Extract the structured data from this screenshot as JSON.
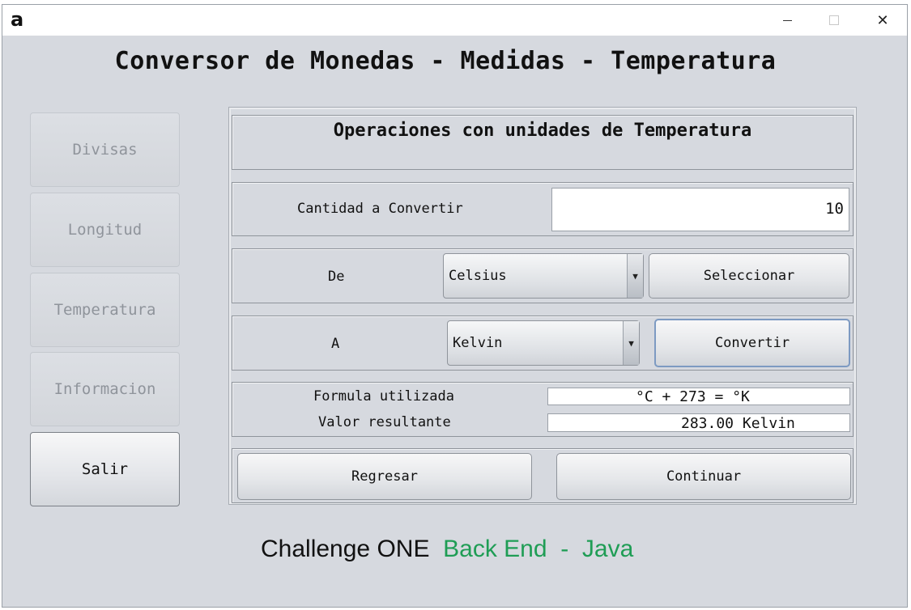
{
  "window": {
    "app_icon": "a",
    "minimize_icon": "minimize-icon",
    "maximize_icon": "maximize-icon",
    "close_icon": "close-icon",
    "close_glyph": "✕"
  },
  "app_title": "Conversor de Monedas - Medidas - Temperatura",
  "sidebar": {
    "items": [
      {
        "label": "Divisas"
      },
      {
        "label": "Longitud"
      },
      {
        "label": "Temperatura"
      },
      {
        "label": "Informacion"
      },
      {
        "label": "Salir"
      }
    ]
  },
  "panel": {
    "title": "Operaciones con unidades de Temperatura",
    "amount_label": "Cantidad a Convertir",
    "amount_value": "10",
    "from_label": "De",
    "from_value": "Celsius",
    "select_button": "Seleccionar",
    "to_label": "A",
    "to_value": "Kelvin",
    "convert_button": "Convertir",
    "formula_label": "Formula utilizada",
    "formula_value": "°C + 273 = °K",
    "result_label": "Valor resultante",
    "result_value": "283.00 Kelvin",
    "back_button": "Regresar",
    "continue_button": "Continuar"
  },
  "footer": {
    "part1": "Challenge ONE",
    "part2": "Back End",
    "sep": "-",
    "part3": "Java"
  },
  "colors": {
    "accent_green": "#1f9d55",
    "window_bg": "#d6d9df"
  }
}
